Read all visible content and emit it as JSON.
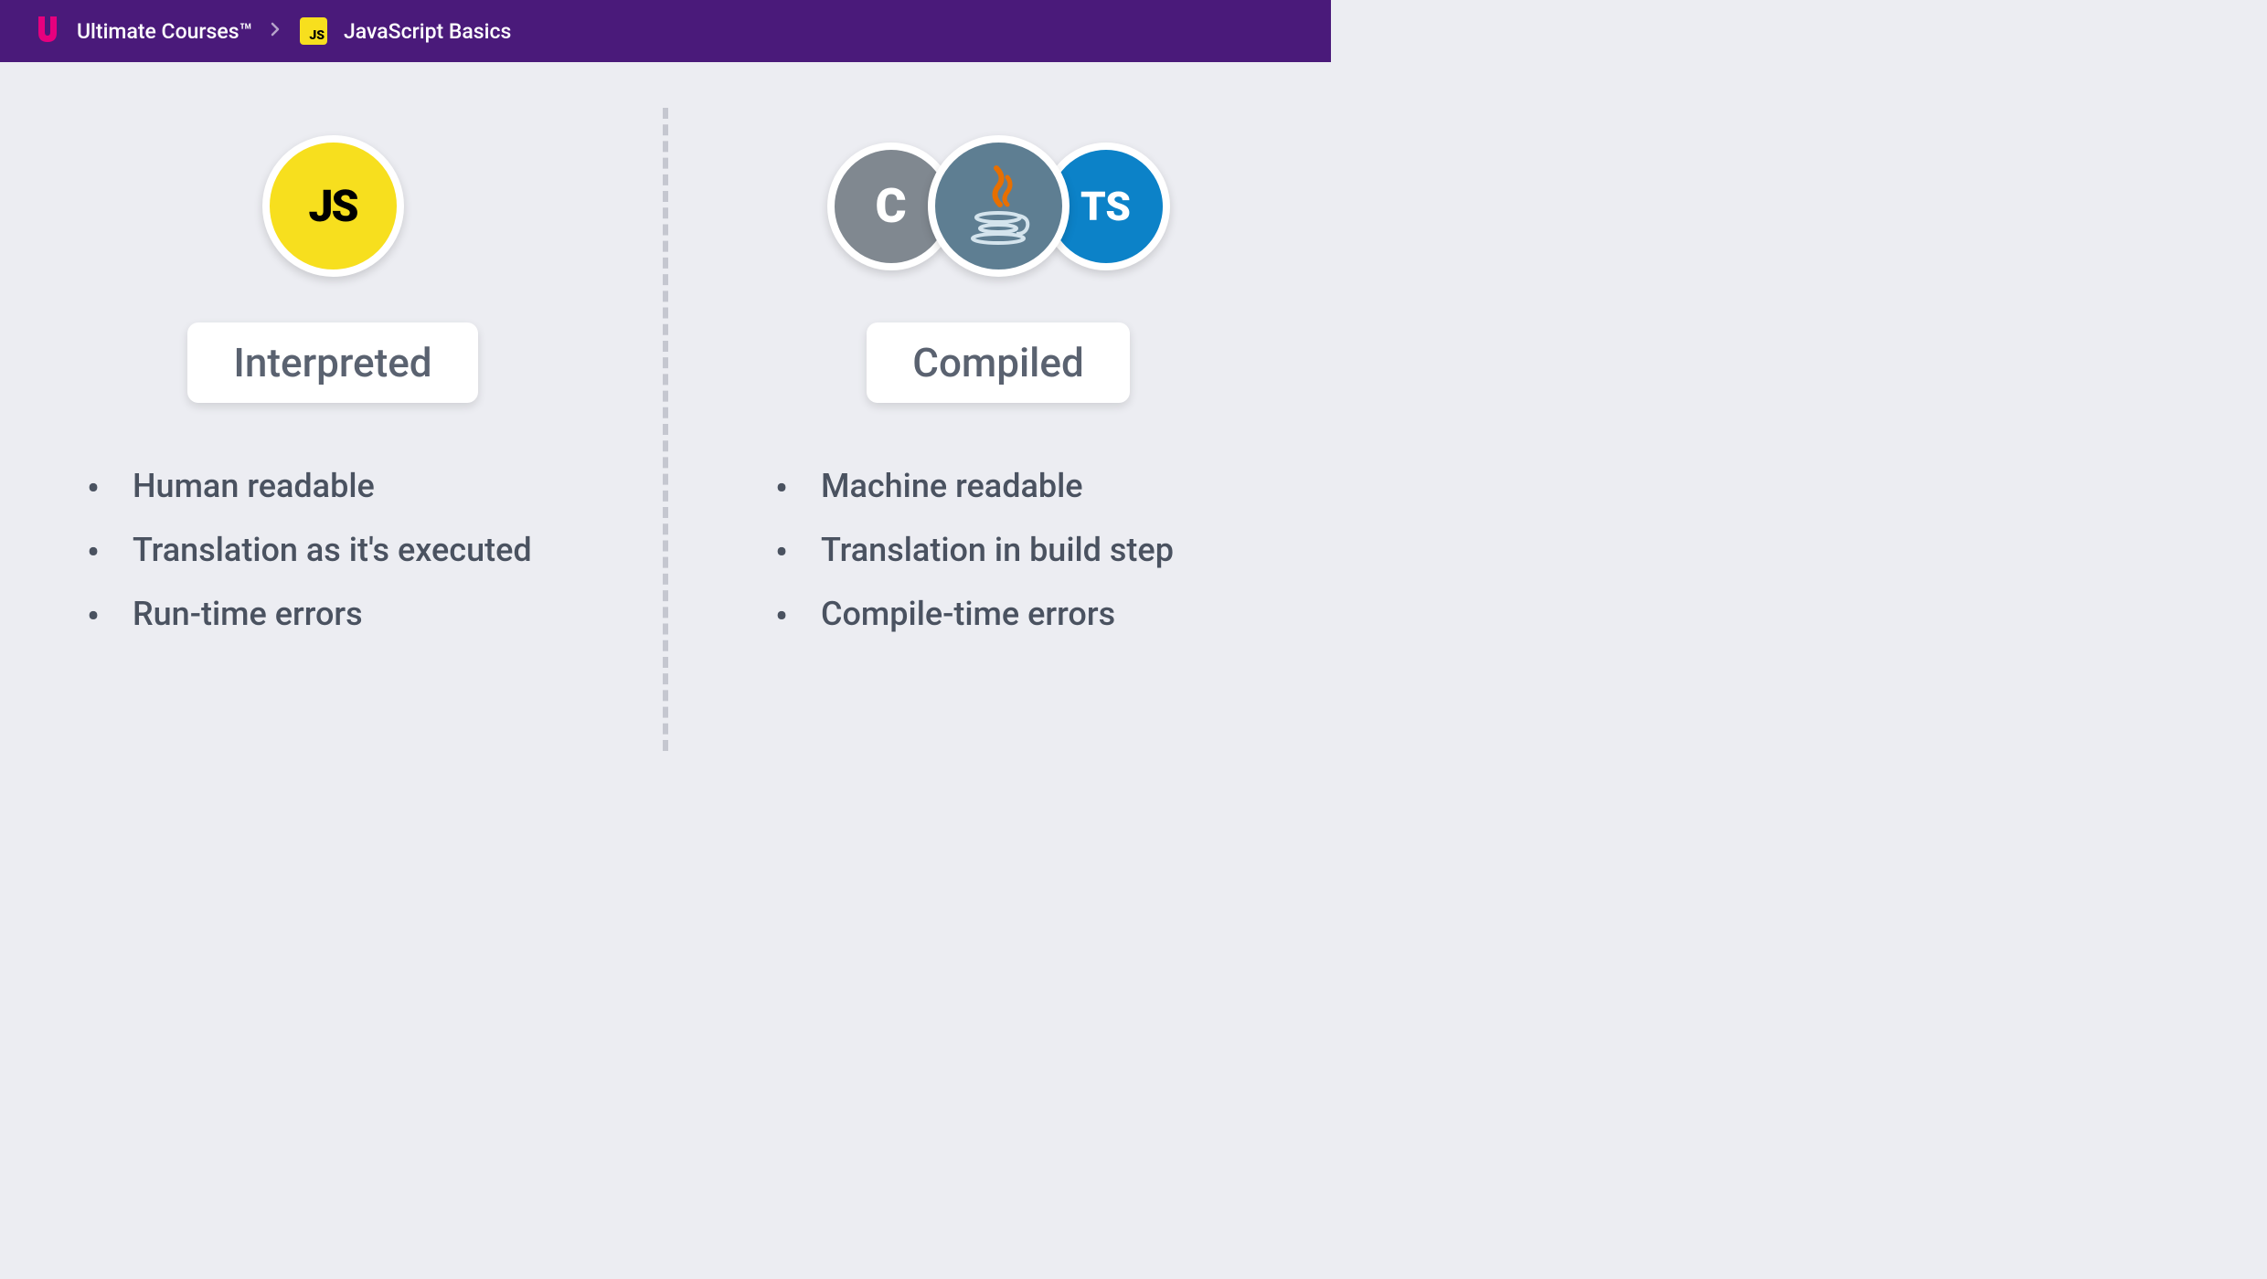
{
  "header": {
    "brand": "Ultimate Courses™",
    "js_badge": "JS",
    "course": "JavaScript Basics"
  },
  "left": {
    "icon_label": "JS",
    "title": "Interpreted",
    "bullets": [
      "Human readable",
      "Translation as it's executed",
      "Run-time errors"
    ]
  },
  "right": {
    "c_label": "C",
    "ts_label": "TS",
    "title": "Compiled",
    "bullets": [
      "Machine readable",
      "Translation in build step",
      "Compile-time errors"
    ]
  }
}
